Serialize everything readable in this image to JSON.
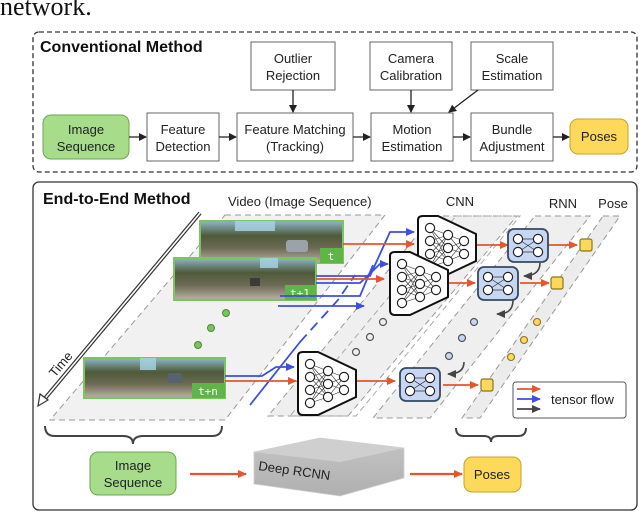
{
  "caption_fragment": "network.",
  "conventional": {
    "title": "Conventional Method",
    "boxes": {
      "image_sequence": [
        "Image",
        "Sequence"
      ],
      "feature_detection": [
        "Feature",
        "Detection"
      ],
      "feature_matching": [
        "Feature Matching",
        "(Tracking)"
      ],
      "motion_estimation": [
        "Motion",
        "Estimation"
      ],
      "bundle_adjustment": [
        "Bundle",
        "Adjustment"
      ],
      "poses": [
        "Poses"
      ],
      "outlier_rejection": [
        "Outlier",
        "Rejection"
      ],
      "camera_calibration": [
        "Camera",
        "Calibration"
      ],
      "scale_estimation": [
        "Scale",
        "Estimation"
      ]
    }
  },
  "end_to_end": {
    "title": "End-to-End Method",
    "column_labels": {
      "video": "Video (Image Sequence)",
      "cnn": "CNN",
      "rnn": "RNN",
      "pose": "Pose"
    },
    "time_label": "Time",
    "frame_tags": [
      "t",
      "t+1",
      "t+n"
    ],
    "bottom": {
      "image_sequence": [
        "Image",
        "Sequence"
      ],
      "deep_rcnn": "Deep RCNN",
      "poses": "Poses"
    },
    "legend": {
      "label": "tensor flow",
      "colors": [
        "#e8552b",
        "#3b4fe0",
        "#444444"
      ]
    }
  },
  "colors": {
    "green_fill": "#a6dc8a",
    "green_stroke": "#6aa84f",
    "yellow_fill": "#fcd95b",
    "yellow_stroke": "#c9a227",
    "blue_fill": "#c7d6f3",
    "blue_stroke": "#34495e",
    "orange_arrow": "#e8552b",
    "blue_arrow": "#3b4fe0",
    "gray_arrow": "#444444"
  }
}
